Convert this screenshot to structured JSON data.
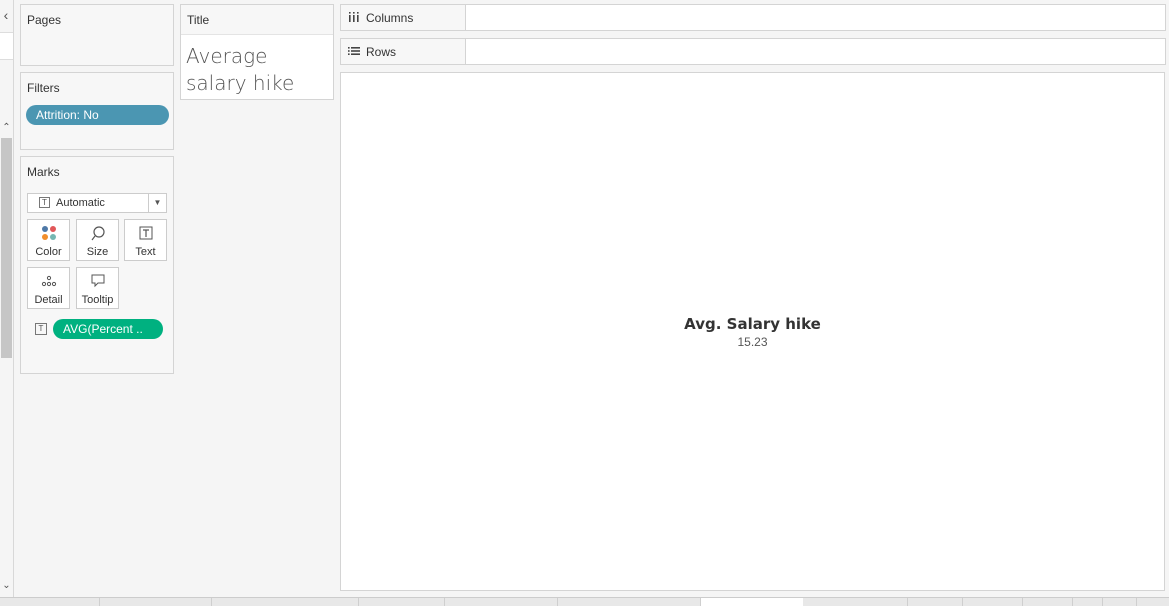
{
  "sidebar": {
    "collapse_glyph": "‹",
    "scroll_up_glyph": "⌃",
    "scroll_down_glyph": "⌄"
  },
  "pages": {
    "title": "Pages"
  },
  "filters": {
    "title": "Filters",
    "items": [
      {
        "label": "Attrition: No",
        "color": "#4b96b2"
      }
    ]
  },
  "marks": {
    "title": "Marks",
    "type_selected": "Automatic",
    "buttons": [
      {
        "label": "Color",
        "icon": "color-dots-icon"
      },
      {
        "label": "Size",
        "icon": "size-lasso-icon"
      },
      {
        "label": "Text",
        "icon": "text-t-icon"
      },
      {
        "label": "Detail",
        "icon": "detail-dots-icon"
      },
      {
        "label": "Tooltip",
        "icon": "tooltip-bubble-icon"
      }
    ],
    "fields": [
      {
        "label": "AVG(Percent ..",
        "color": "#00b180",
        "encoding": "text"
      }
    ]
  },
  "title_card": {
    "header": "Title",
    "text": "Average salary hike"
  },
  "shelves": {
    "columns": {
      "label": "Columns",
      "icon": "columns-icon"
    },
    "rows": {
      "label": "Rows",
      "icon": "rows-icon"
    }
  },
  "view": {
    "measure_label": "Avg. Salary hike",
    "measure_value": "15.23"
  }
}
